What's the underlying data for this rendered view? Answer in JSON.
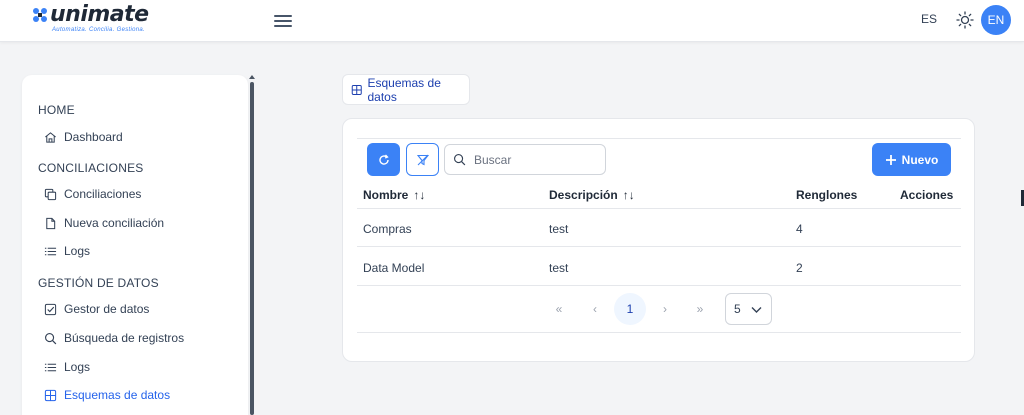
{
  "app": {
    "logo_text": "unimate",
    "tagline": "Automatiza. Concilia. Gestiona.",
    "lang_current": "ES",
    "lang_alt": "EN"
  },
  "sidebar": {
    "sections": [
      {
        "title": "HOME",
        "items": [
          {
            "label": "Dashboard",
            "icon": "home-icon"
          }
        ]
      },
      {
        "title": "CONCILIACIONES",
        "items": [
          {
            "label": "Conciliaciones",
            "icon": "copy-icon"
          },
          {
            "label": "Nueva conciliación",
            "icon": "file-icon"
          },
          {
            "label": "Logs",
            "icon": "list-icon"
          }
        ]
      },
      {
        "title": "GESTIÓN DE DATOS",
        "items": [
          {
            "label": "Gestor de datos",
            "icon": "check-square-icon"
          },
          {
            "label": "Búsqueda de registros",
            "icon": "search-icon"
          },
          {
            "label": "Logs",
            "icon": "list-icon"
          },
          {
            "label": "Esquemas de datos",
            "icon": "table-icon",
            "active": true
          }
        ]
      }
    ]
  },
  "breadcrumb": {
    "label": "Esquemas de datos"
  },
  "toolbar": {
    "search_placeholder": "Buscar",
    "new_label": "Nuevo"
  },
  "table": {
    "columns": [
      "Nombre",
      "Descripción",
      "Renglones",
      "Acciones"
    ],
    "sort_indicator": "↑↓",
    "rows": [
      {
        "nombre": "Compras",
        "descripcion": "test",
        "renglones": "4"
      },
      {
        "nombre": "Data Model",
        "descripcion": "test",
        "renglones": "2"
      }
    ]
  },
  "pagination": {
    "first": "«",
    "prev": "‹",
    "current_page": "1",
    "next": "›",
    "last": "»",
    "rows_per_page": "5"
  },
  "colors": {
    "accent": "#3b82f6",
    "active_text": "#2563eb"
  }
}
